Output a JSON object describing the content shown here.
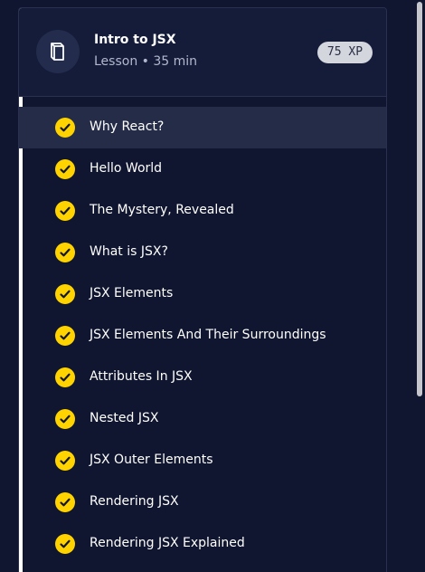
{
  "lesson": {
    "title": "Intro to JSX",
    "subtitle": "Lesson • 35 min",
    "xp": "75 XP",
    "icon": "book-icon"
  },
  "items": [
    {
      "label": "Why React?",
      "completed": true,
      "active": true
    },
    {
      "label": "Hello World",
      "completed": true
    },
    {
      "label": "The Mystery, Revealed",
      "completed": true
    },
    {
      "label": "What is JSX?",
      "completed": true
    },
    {
      "label": "JSX Elements",
      "completed": true
    },
    {
      "label": "JSX Elements And Their Surroundings",
      "completed": true
    },
    {
      "label": "Attributes In JSX",
      "completed": true
    },
    {
      "label": "Nested JSX",
      "completed": true
    },
    {
      "label": "JSX Outer Elements",
      "completed": true
    },
    {
      "label": "Rendering JSX",
      "completed": true
    },
    {
      "label": "Rendering JSX Explained",
      "completed": true
    }
  ],
  "colors": {
    "background": "#10162f",
    "check": "#ffd300",
    "active_row": "#252c47"
  }
}
